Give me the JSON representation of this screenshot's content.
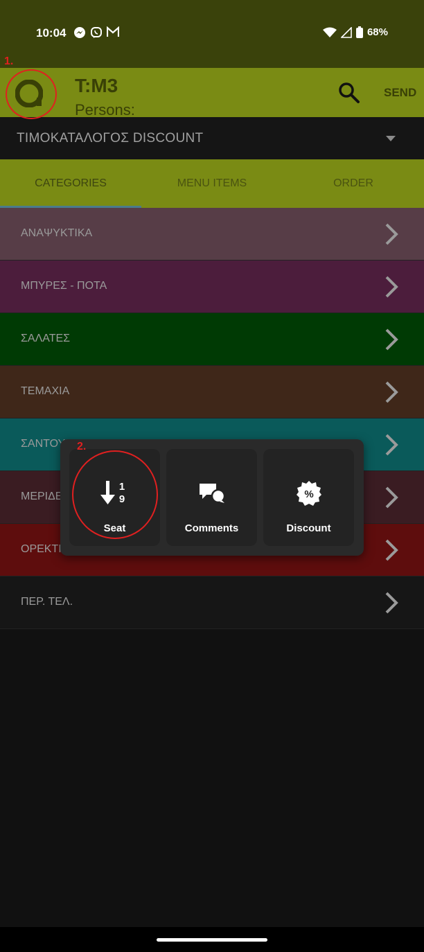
{
  "status_bar": {
    "time": "10:04",
    "battery": "68%",
    "left_icons": [
      "messenger-icon",
      "viber-icon",
      "gmail-icon"
    ],
    "right_icons": [
      "wifi-icon",
      "signal-icon",
      "battery-icon"
    ]
  },
  "app_bar": {
    "title": "T:M3",
    "subtitle": "Persons:",
    "send_label": "SEND"
  },
  "price_list": {
    "selected": "ΤΙΜΟΚΑΤΑΛΟΓΟΣ DISCOUNT"
  },
  "tabs": [
    {
      "label": "CATEGORIES",
      "active": true
    },
    {
      "label": "MENU ITEMS",
      "active": false
    },
    {
      "label": "ORDER",
      "active": false
    }
  ],
  "categories": [
    {
      "label": "ΑΝΑΨΥΚΤΙΚΑ",
      "color": "#573d47"
    },
    {
      "label": "ΜΠΥΡΕΣ -  ΠΟΤΑ",
      "color": "#4c1d3c"
    },
    {
      "label": "ΣΑΛΑΤΕΣ",
      "color": "#003a04"
    },
    {
      "label": "ΤΕΜΑΧΙΑ",
      "color": "#3f2719"
    },
    {
      "label": "ΣΑΝΤΟΥΙΤΣ",
      "color": "#0a5a5a"
    },
    {
      "label": "ΜΕΡΙΔΕΣ",
      "color": "#3a1c22"
    },
    {
      "label": "ΟΡΕΚΤΙΚΑ",
      "color": "#5e0d0d"
    },
    {
      "label": "ΠΕΡ. ΤΕΛ.",
      "color": "#161616"
    }
  ],
  "popup": {
    "buttons": [
      {
        "label": "Seat",
        "icon": "sort-numeric-down-icon"
      },
      {
        "label": "Comments",
        "icon": "comments-icon"
      },
      {
        "label": "Discount",
        "icon": "discount-badge-icon"
      }
    ]
  },
  "annotations": {
    "first": "1.",
    "second": "2."
  }
}
